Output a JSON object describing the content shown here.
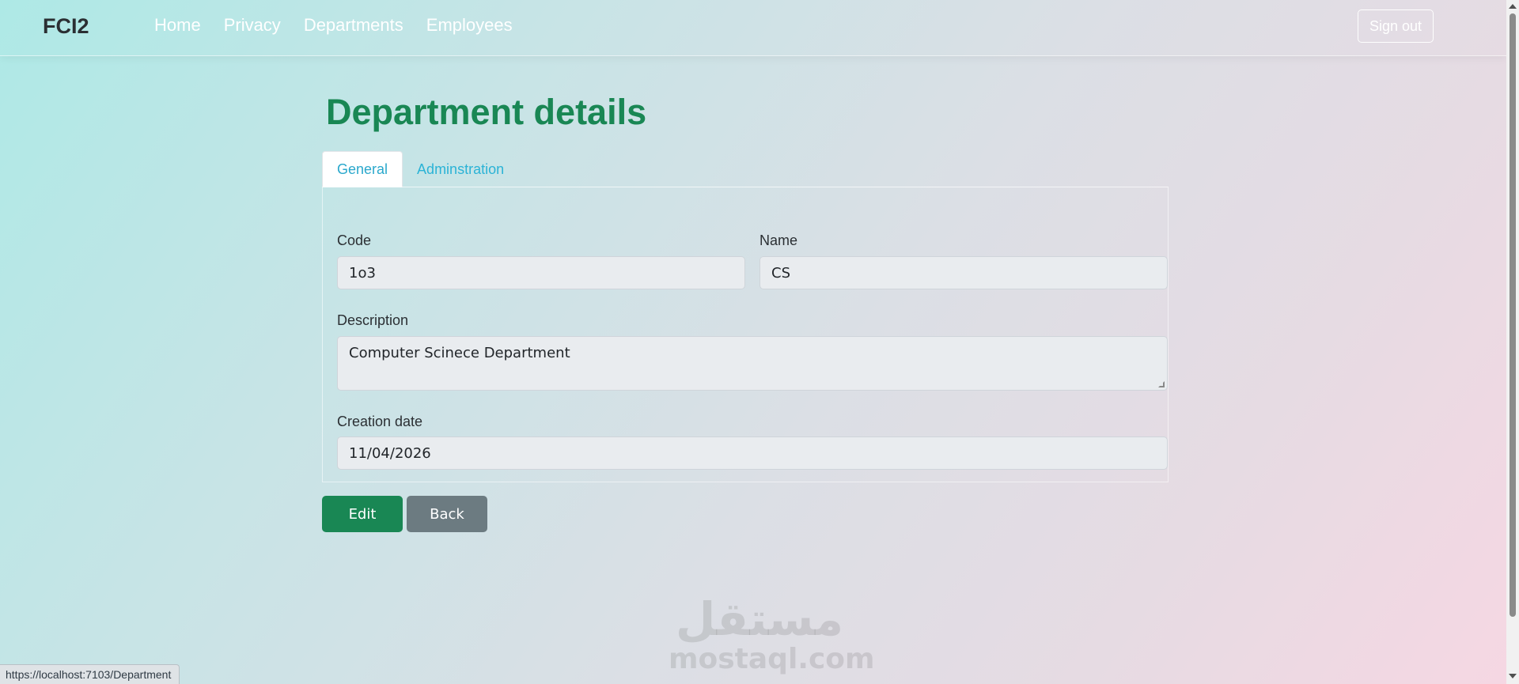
{
  "navbar": {
    "brand": "FCI2",
    "links": [
      "Home",
      "Privacy",
      "Departments",
      "Employees"
    ],
    "signout_label": "Sign out"
  },
  "page": {
    "title": "Department details"
  },
  "tabs": [
    {
      "label": "General",
      "active": true
    },
    {
      "label": "Adminstration",
      "active": false
    }
  ],
  "form": {
    "code_label": "Code",
    "code_value": "1o3",
    "name_label": "Name",
    "name_value": "CS",
    "description_label": "Description",
    "description_value": "Computer Scinece Department",
    "creation_date_label": "Creation date",
    "creation_date_value": "11/04/2026"
  },
  "actions": {
    "edit_label": "Edit",
    "back_label": "Back"
  },
  "watermark": {
    "arabic": "مستقل",
    "latin": "mostaql.com"
  },
  "statusbar": {
    "url": "https://localhost:7103/Department"
  },
  "colors": {
    "accent_green": "#198754",
    "secondary_gray": "#6c7b81",
    "tab_link": "#2bb3d6"
  }
}
